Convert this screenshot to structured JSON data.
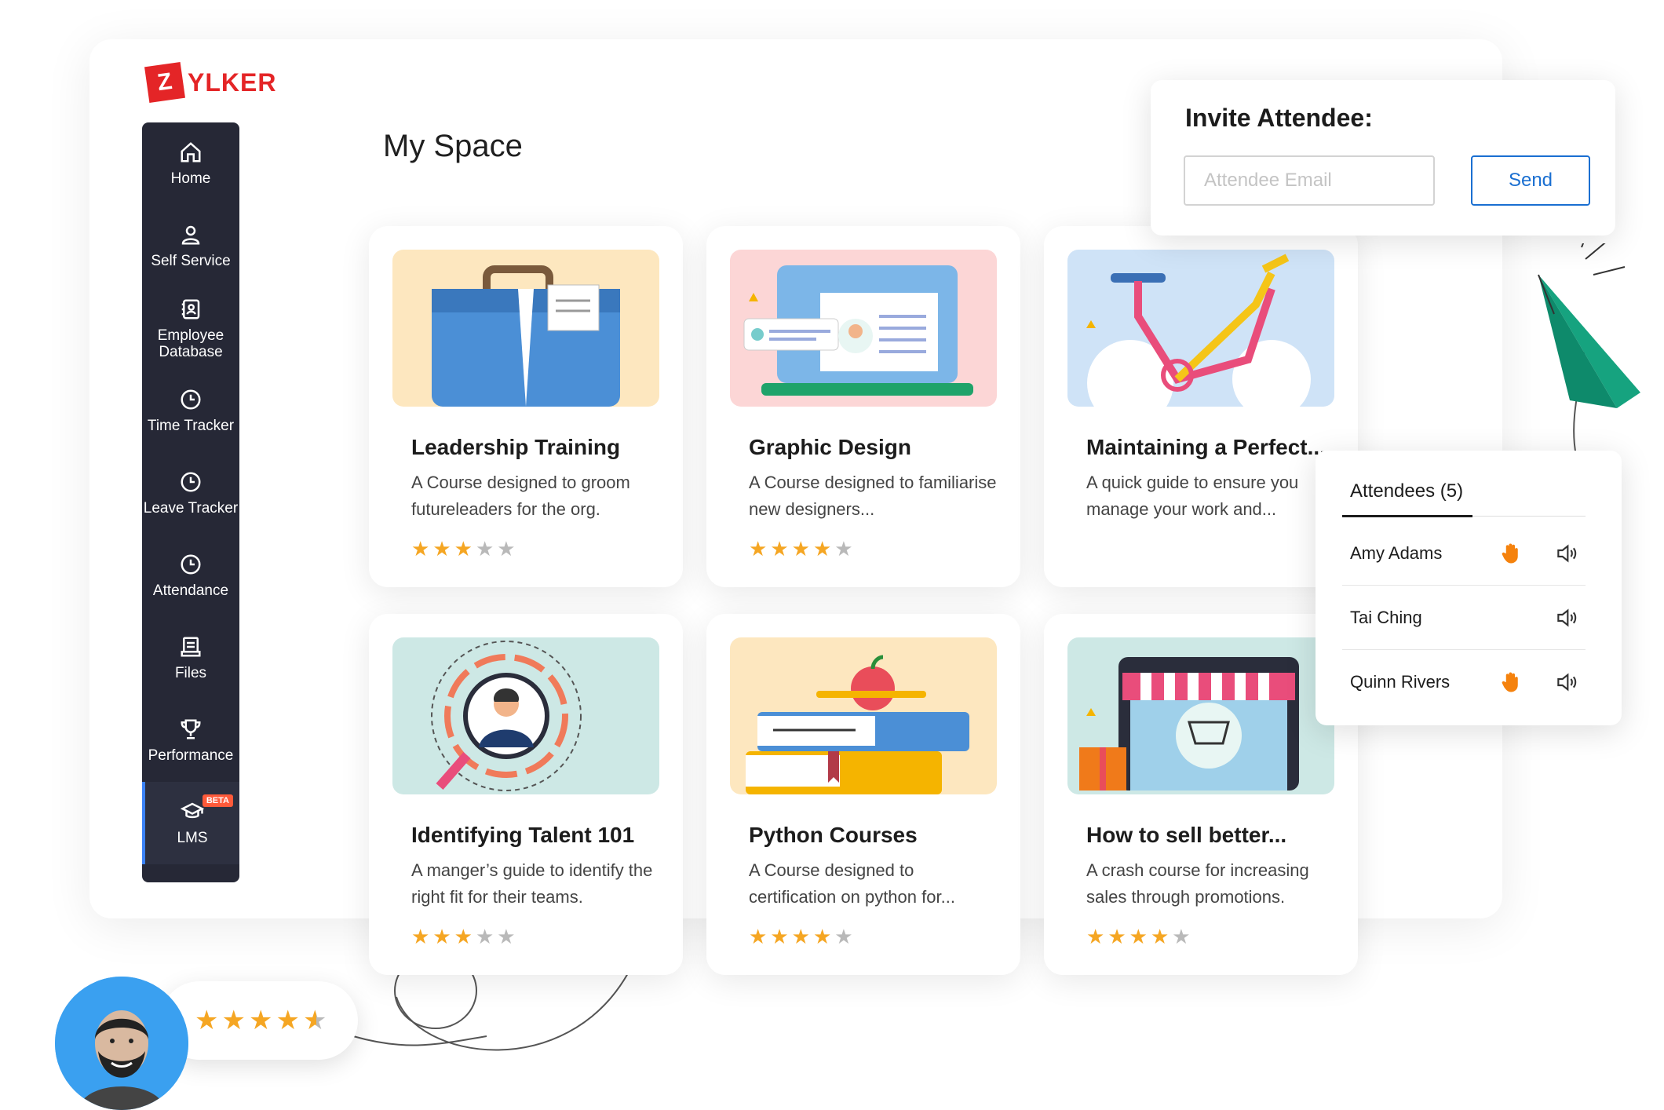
{
  "brand": {
    "logo_letter": "Z",
    "logo_text": "YLKER",
    "color": "#e42527"
  },
  "sidebar": {
    "items": [
      {
        "label": "Home",
        "icon": "home-icon"
      },
      {
        "label": "Self Service",
        "icon": "user-icon"
      },
      {
        "label": "Employee Database",
        "icon": "contact-book-icon"
      },
      {
        "label": "Time Tracker",
        "icon": "clock-icon"
      },
      {
        "label": "Leave Tracker",
        "icon": "clock-icon"
      },
      {
        "label": "Attendance",
        "icon": "clock-icon"
      },
      {
        "label": "Files",
        "icon": "files-icon"
      },
      {
        "label": "Performance",
        "icon": "trophy-icon"
      },
      {
        "label": "LMS",
        "icon": "graduation-cap-icon",
        "badge": "BETA",
        "active": true
      }
    ]
  },
  "page": {
    "title": "My Space"
  },
  "courses": [
    {
      "title": "Leadership Training",
      "desc": "A Course designed to groom futureleaders for the org.",
      "rating": 3
    },
    {
      "title": "Graphic Design",
      "desc": "A Course designed to familiarise new designers...",
      "rating": 4
    },
    {
      "title": "Maintaining a Perfect...",
      "desc": "A quick guide to ensure you manage your work and...",
      "rating": 0
    },
    {
      "title": "Identifying Talent 101",
      "desc": "A manger’s guide to identify the right fit for their teams.",
      "rating": 3
    },
    {
      "title": "Python Courses",
      "desc": "A Course designed to certification on python for...",
      "rating": 4
    },
    {
      "title": "How to sell better...",
      "desc": "A crash course for increasing sales through promotions.",
      "rating": 4
    }
  ],
  "invite": {
    "title": "Invite Attendee:",
    "email_placeholder": "Attendee Email",
    "send_label": "Send"
  },
  "attendees": {
    "tab_label": "Attendees (5)",
    "list": [
      {
        "name": "Amy Adams",
        "hand_raised": true
      },
      {
        "name": "Tai Ching",
        "hand_raised": false
      },
      {
        "name": "Quinn Rivers",
        "hand_raised": true
      }
    ]
  },
  "review": {
    "rating": 4.5
  },
  "colors": {
    "accent": "#1a6fd1",
    "sidebar_bg": "#262836",
    "star": "#f5a623",
    "hand": "#f5820d"
  }
}
